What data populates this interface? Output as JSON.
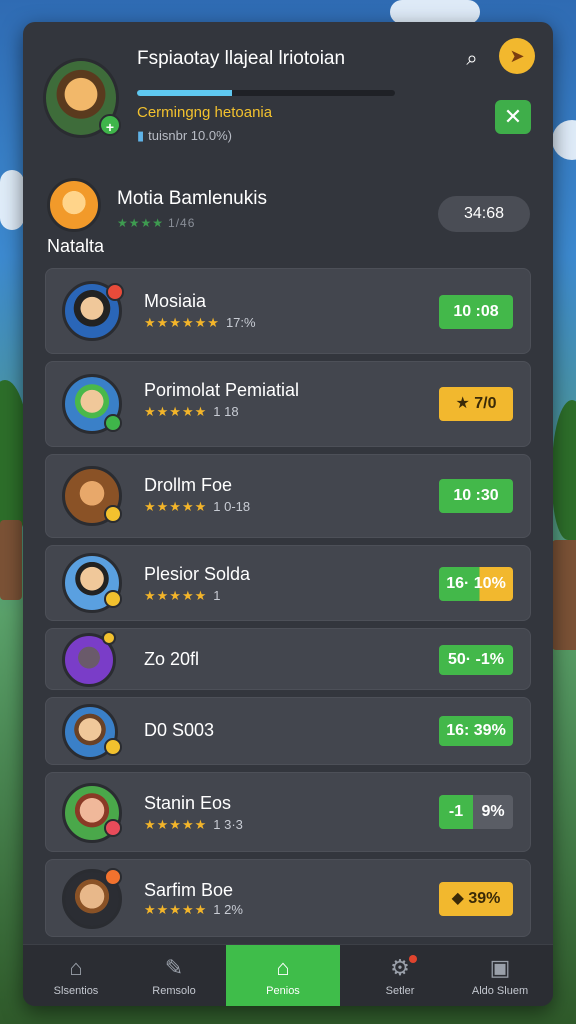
{
  "header": {
    "title": "Fspiaotay llajeal lriotoian",
    "progress": 0.37,
    "subtitle": "Cermingng hetoania",
    "meta": "tuisnbr 10.0%)"
  },
  "leader": {
    "name": "Motia Bamlenukis",
    "rating": "1/46",
    "timer": "34:68",
    "section_label": "Natalta"
  },
  "players": [
    {
      "name": "Mosiaia",
      "stars": "★★★★★★",
      "rating": "17:%",
      "score": "10 :08",
      "score_color": "#43b84a",
      "avatar_color": "#2a66b8"
    },
    {
      "name": "Porimolat Pemiatial",
      "stars": "★★★★★",
      "rating": "1 18",
      "score": "7/0",
      "score_icon": "★",
      "score_color": "#f2b82e",
      "avatar_color": "#3a80c8"
    },
    {
      "name": "Drollm Foe",
      "stars": "★★★★★",
      "rating": "1 0-18",
      "score": "10 :30",
      "score_color": "#43b84a",
      "avatar_color": "#a56b38"
    },
    {
      "name": "Plesior Solda",
      "stars": "★★★★★",
      "rating": "1",
      "score": "16· 10%",
      "score_color": "#43b84a",
      "score_color2": "#f2b82e",
      "avatar_color": "#3a80c8"
    },
    {
      "name": "Zo 20fl",
      "stars": "",
      "rating": "",
      "score": "50· -1%",
      "score_color": "#43b84a",
      "avatar_color": "#7a3dc8"
    },
    {
      "name": "D0 S003",
      "stars": "",
      "rating": "",
      "score": "16: 39%",
      "score_color": "#43b84a",
      "avatar_color": "#3a80c8"
    },
    {
      "name": "Stanin Eos",
      "stars": "★★★★★",
      "rating": "1 3·3",
      "score_a": "-1",
      "score_b": "9%",
      "score_color": "#43b84a",
      "score_color2": "#5a5d65",
      "avatar_color": "#4aa84a"
    },
    {
      "name": "Sarfim Boe",
      "stars": "★★★★★",
      "rating": "1 2%",
      "score": "39%",
      "score_icon": "◆",
      "score_color": "#f2b82e",
      "avatar_color": "#2b2d33"
    }
  ],
  "tabs": [
    {
      "label": "Slsentios",
      "icon": "home-icon",
      "glyph": "⌂"
    },
    {
      "label": "Remsolo",
      "icon": "edit-icon",
      "glyph": "✎"
    },
    {
      "label": "Penios",
      "icon": "house-icon",
      "glyph": "⌂"
    },
    {
      "label": "Setler",
      "icon": "gear-icon",
      "glyph": "⚙"
    },
    {
      "label": "Aldo Sluem",
      "icon": "inbox-icon",
      "glyph": "▣"
    }
  ],
  "colors": {
    "panel": "#33363d",
    "accent_green": "#3fbd4a",
    "accent_gold": "#f2b82e",
    "progress": "#5fc8f0"
  }
}
